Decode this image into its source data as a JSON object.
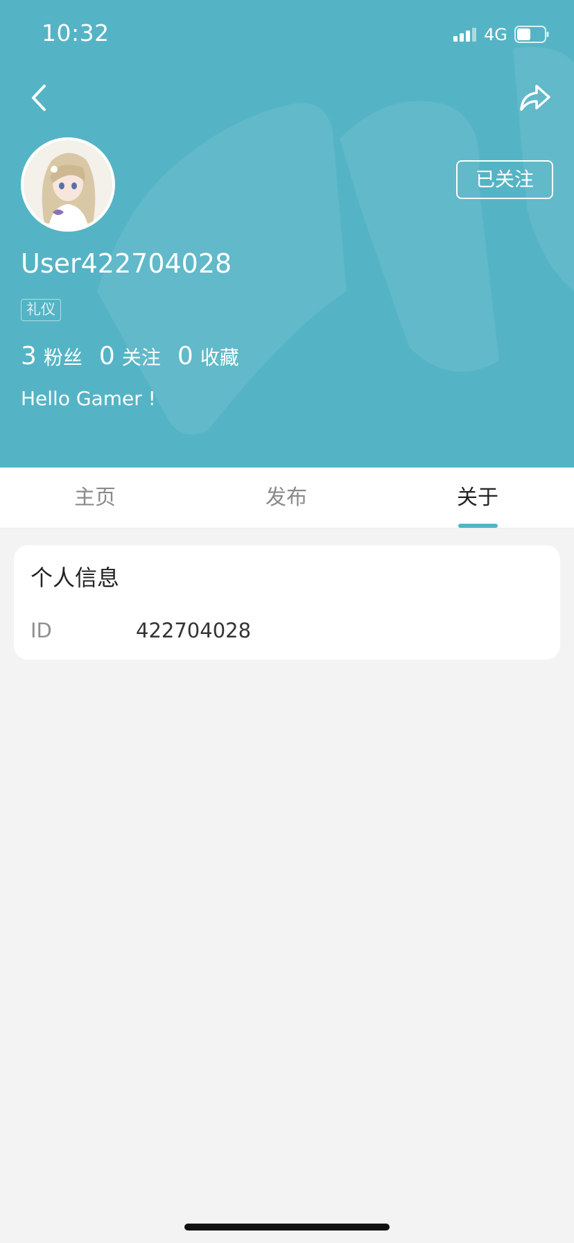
{
  "status_bar": {
    "time": "10:32",
    "network": "4G",
    "battery_level": 0.5
  },
  "header": {
    "back_icon": "chevron-left-icon",
    "share_icon": "share-arrow-icon",
    "background_color": "#54b4c5",
    "follow_label": "已关注",
    "username": "User422704028",
    "tag": "礼仪",
    "stats": [
      {
        "value": "3",
        "label": "粉丝"
      },
      {
        "value": "0",
        "label": "关注"
      },
      {
        "value": "0",
        "label": "收藏"
      }
    ],
    "bio": "Hello Gamer !"
  },
  "tabs": [
    {
      "label": "主页",
      "active": false
    },
    {
      "label": "发布",
      "active": false
    },
    {
      "label": "关于",
      "active": true
    }
  ],
  "accent_color": "#54b4c5",
  "about": {
    "title": "个人信息",
    "rows": [
      {
        "label": "ID",
        "value": "422704028"
      }
    ]
  }
}
